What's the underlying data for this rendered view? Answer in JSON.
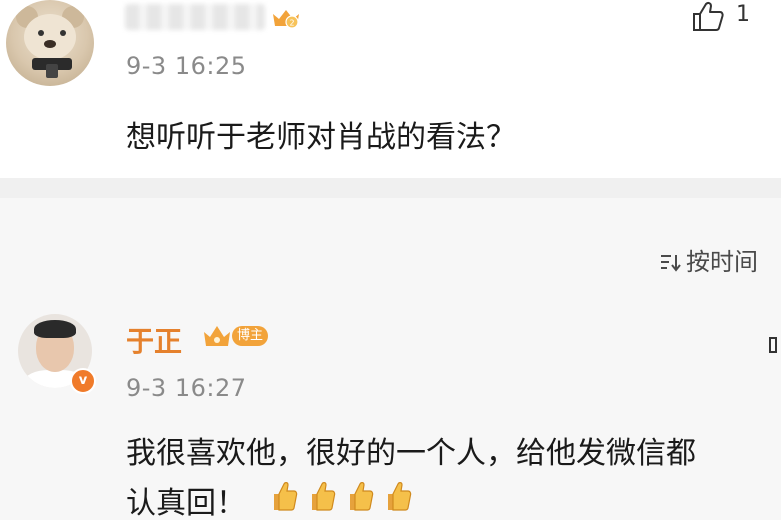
{
  "top_comment": {
    "name": "",
    "badge_icon": "crown-level-badge",
    "like_icon": "thumbs-up-icon",
    "like_count": "1",
    "time": "9-3 16:25",
    "text": "想听听于老师对肖战的看法？"
  },
  "sort": {
    "icon": "sort-icon",
    "label": "按时间"
  },
  "reply_comment": {
    "name": "于正",
    "host_badge": "博主",
    "verified_icon": "v",
    "time": "9-3 16:27",
    "text_line1": "我很喜欢他，很好的一个人，给他发微信都",
    "text_line2": "认真回！",
    "emoji": [
      "thumbs-up-emoji",
      "thumbs-up-emoji",
      "thumbs-up-emoji",
      "thumbs-up-emoji"
    ]
  },
  "colors": {
    "accent_orange": "#e5812d",
    "badge_orange": "#f2a33a",
    "meta_gray": "#8a8a8a",
    "section_bg": "#f7f7f7"
  }
}
